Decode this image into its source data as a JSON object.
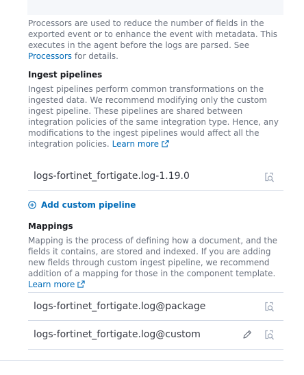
{
  "processors": {
    "text": "Processors are used to reduce the number of fields in the exported event or to enhance the event with metadata. This executes in the agent before the logs are parsed. See ",
    "link": "Processors",
    "suffix": " for details."
  },
  "ingest": {
    "title": "Ingest pipelines",
    "text": "Ingest pipelines perform common transformations on the ingested data. We recommend modifying only the custom ingest pipeline. These pipelines are shared between integration policies of the same integration type. Hence, any modifications to the ingest pipelines would affect all the integration policies. ",
    "learn_more": "Learn more",
    "pipelines": [
      {
        "name": "logs-fortinet_fortigate.log-1.19.0"
      }
    ],
    "add_label": "Add custom pipeline"
  },
  "mappings": {
    "title": "Mappings",
    "text": "Mapping is the process of defining how a document, and the fields it contains, are stored and indexed. If you are adding new fields through custom ingest pipeline, we recommend addition of a mapping for those in the component template. ",
    "learn_more": "Learn more",
    "items": [
      {
        "name": "logs-fortinet_fortigate.log@package"
      },
      {
        "name": "logs-fortinet_fortigate.log@custom"
      }
    ]
  },
  "icons": {
    "inspect": "inspect-icon",
    "edit": "pencil-icon",
    "add": "plus-in-circle-icon",
    "external": "popout-icon"
  },
  "colors": {
    "link": "#006bb8",
    "text_subdued": "#69707d",
    "border": "#d3dae6"
  }
}
